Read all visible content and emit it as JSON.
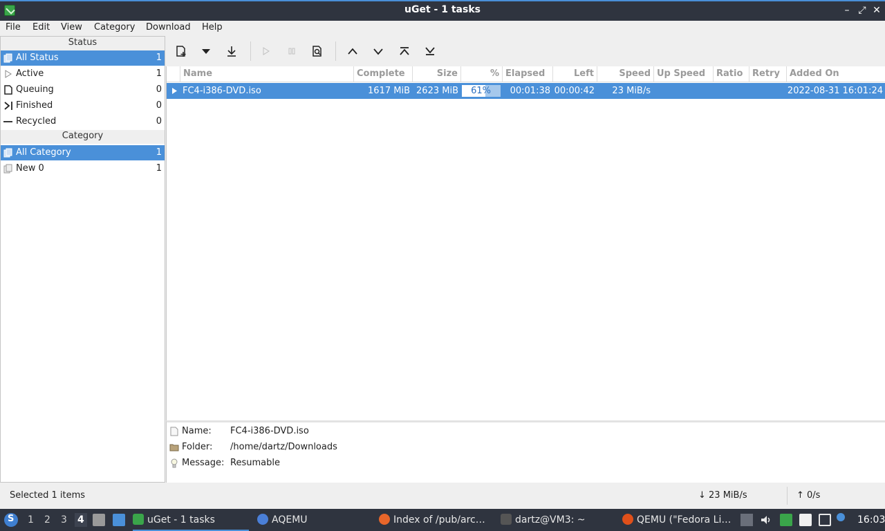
{
  "window": {
    "title": "uGet - 1 tasks",
    "min": "–",
    "max": "⤢",
    "close": "✕"
  },
  "menu": [
    "File",
    "Edit",
    "View",
    "Category",
    "Download",
    "Help"
  ],
  "sidebar": {
    "status_header": "Status",
    "status_items": [
      {
        "label": "All Status",
        "count": "1"
      },
      {
        "label": "Active",
        "count": "1"
      },
      {
        "label": "Queuing",
        "count": "0"
      },
      {
        "label": "Finished",
        "count": "0"
      },
      {
        "label": "Recycled",
        "count": "0"
      }
    ],
    "category_header": "Category",
    "category_items": [
      {
        "label": "All Category",
        "count": "1"
      },
      {
        "label": "New 0",
        "count": "1"
      }
    ]
  },
  "columns": [
    "Name",
    "Complete",
    "Size",
    "%",
    "Elapsed",
    "Left",
    "Speed",
    "Up Speed",
    "Ratio",
    "Retry",
    "Added On"
  ],
  "tasks": [
    {
      "name": "FC4-i386-DVD.iso",
      "complete": "1617 MiB",
      "size": "2623 MiB",
      "percent_label": "61%",
      "percent": 61,
      "elapsed": "00:01:38",
      "left": "00:00:42",
      "speed": "23 MiB/s",
      "up_speed": "",
      "ratio": "",
      "retry": "",
      "added_on": "2022-08-31 16:01:24"
    }
  ],
  "details": {
    "name_key": "Name:",
    "name_val": "FC4-i386-DVD.iso",
    "folder_key": "Folder:",
    "folder_val": "/home/dartz/Downloads",
    "message_key": "Message:",
    "message_val": "Resumable"
  },
  "statusbar": {
    "selected": "Selected 1 items",
    "down": "↓  23 MiB/s",
    "up": "↑  0/s"
  },
  "taskbar": {
    "workspaces": [
      "1",
      "2",
      "3",
      "4"
    ],
    "apps": [
      {
        "label": "uGet - 1 tasks",
        "color": "#3aa54a"
      },
      {
        "label": "AQEMU",
        "color": "#4a7fd8"
      },
      {
        "label": "Index of /pub/arc…",
        "color": "#e8662a"
      },
      {
        "label": "dartz@VM3: ~",
        "color": "#555555"
      },
      {
        "label": "QEMU (\"Fedora Li…",
        "color": "#e0501a"
      }
    ],
    "clock": "16:03"
  },
  "colors": {
    "selection": "#4a90d9",
    "titlebar": "#2f343f"
  }
}
